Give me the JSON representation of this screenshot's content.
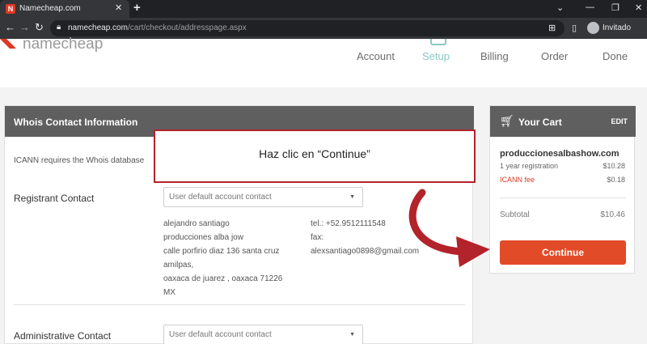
{
  "browser": {
    "tab_title": "Namecheap.com",
    "url_host": "namecheap.com",
    "url_path": "/cart/checkout/addresspage.aspx",
    "profile_label": "Invitado"
  },
  "header": {
    "logo_text": "namecheap",
    "steps": [
      "Account",
      "Setup",
      "Billing",
      "Order",
      "Done"
    ],
    "active_step": "Setup"
  },
  "whois": {
    "title": "Whois Contact Information",
    "icann_text": "ICANN requires the Whois database",
    "registrant_label": "Registrant Contact",
    "administrative_label": "Administrative Contact",
    "select_value": "User default account contact",
    "address_lines": [
      "alejandro santiago",
      "producciones alba jow",
      "calle porfirio diaz 136 santa cruz",
      "amilpas,",
      "oaxaca de juarez , oaxaca 71226",
      "MX"
    ],
    "phone": "tel.: +52.9512111548",
    "fax_label": "fax:",
    "email": "alexsantiago0898@gmail.com"
  },
  "cart": {
    "title": "Your Cart",
    "edit_label": "EDIT",
    "domain": "produccionesalbashow.com",
    "registration_label": "1 year registration",
    "registration_price": "$10.28",
    "fee_label": "ICANN fee",
    "fee_price": "$0.18",
    "subtotal_label": "Subtotal",
    "subtotal_price": "$10.46",
    "continue_label": "Continue"
  },
  "callout": {
    "text": "Haz clic en “Continue”"
  },
  "colors": {
    "brand_orange": "#de3723",
    "continue_button": "#e24b27",
    "active_step": "#8ac9c6",
    "panel_header": "#5f5f5f",
    "callout_border": "#b3232b"
  }
}
